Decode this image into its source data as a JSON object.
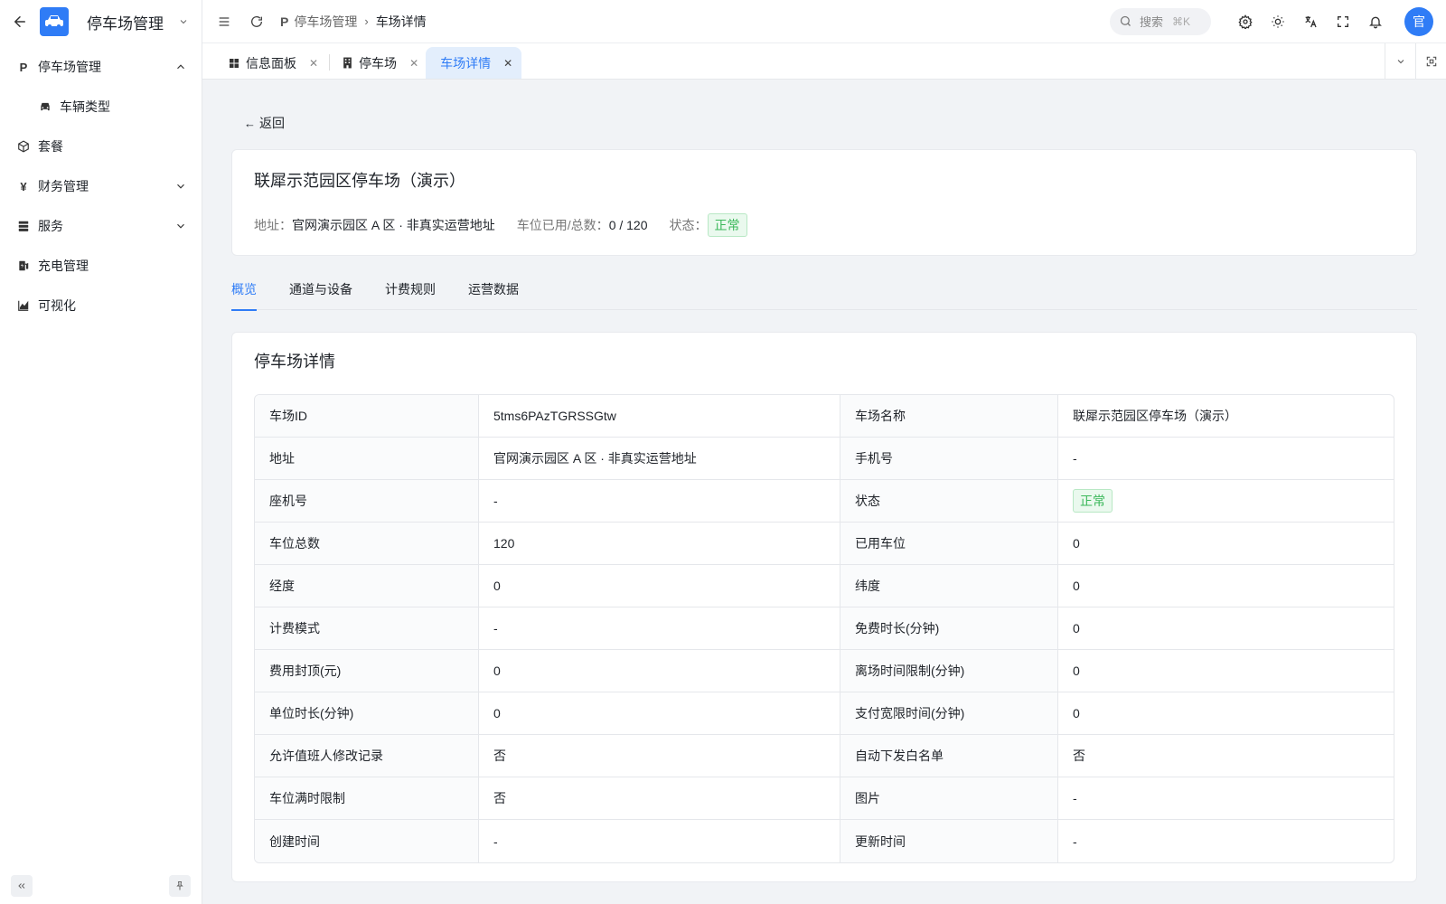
{
  "sidebar": {
    "app_title": "停车场管理",
    "items": [
      {
        "label": "停车场管理",
        "icon": "P"
      },
      {
        "label": "车辆类型"
      },
      {
        "label": "套餐"
      },
      {
        "label": "财务管理",
        "icon": "¥"
      },
      {
        "label": "服务"
      },
      {
        "label": "充电管理"
      },
      {
        "label": "可视化"
      }
    ]
  },
  "header": {
    "breadcrumb": {
      "icon": "P",
      "parent": "停车场管理",
      "current": "车场详情"
    },
    "search": {
      "label": "搜索",
      "shortcut": "⌘K"
    },
    "avatar": "官"
  },
  "tabs": [
    {
      "label": "信息面板"
    },
    {
      "label": "停车场"
    },
    {
      "label": "车场详情"
    }
  ],
  "page": {
    "back_label": "返回",
    "title": "联犀示范园区停车场（演示）",
    "meta": {
      "address_key": "地址：",
      "address_val": "官网演示园区 A 区 · 非真实运营地址",
      "spaces_key": "车位已用/总数：",
      "spaces_val": "0 / 120",
      "status_key": "状态：",
      "status_val": "正常"
    },
    "detail_tabs": [
      "概览",
      "通道与设备",
      "计费规则",
      "运营数据"
    ],
    "detail_title": "停车场详情",
    "rows": [
      {
        "l1": "车场ID",
        "v1": "5tms6PAzTGRSSGtw",
        "l2": "车场名称",
        "v2": "联犀示范园区停车场（演示）"
      },
      {
        "l1": "地址",
        "v1": "官网演示园区 A 区 · 非真实运营地址",
        "l2": "手机号",
        "v2": "-"
      },
      {
        "l1": "座机号",
        "v1": "-",
        "l2": "状态",
        "v2": "正常"
      },
      {
        "l1": "车位总数",
        "v1": "120",
        "l2": "已用车位",
        "v2": "0"
      },
      {
        "l1": "经度",
        "v1": "0",
        "l2": "纬度",
        "v2": "0"
      },
      {
        "l1": "计费模式",
        "v1": "-",
        "l2": "免费时长(分钟)",
        "v2": "0"
      },
      {
        "l1": "费用封顶(元)",
        "v1": "0",
        "l2": "离场时间限制(分钟)",
        "v2": "0"
      },
      {
        "l1": "单位时长(分钟)",
        "v1": "0",
        "l2": "支付宽限时间(分钟)",
        "v2": "0"
      },
      {
        "l1": "允许值班人修改记录",
        "v1": "否",
        "l2": "自动下发白名单",
        "v2": "否"
      },
      {
        "l1": "车位满时限制",
        "v1": "否",
        "l2": "图片",
        "v2": "-"
      },
      {
        "l1": "创建时间",
        "v1": "-",
        "l2": "更新时间",
        "v2": "-"
      }
    ]
  },
  "colors": {
    "primary": "#2f7cf6",
    "success": "#3bb85a"
  }
}
